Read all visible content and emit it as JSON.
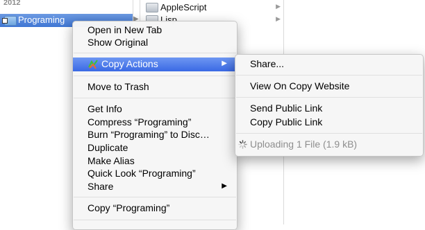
{
  "finder": {
    "year_label": "2012",
    "selected_folder": "Programing",
    "column2_items": [
      {
        "label": "AppleScript"
      },
      {
        "label": "Lisp"
      }
    ]
  },
  "context_menu": {
    "items": [
      {
        "label": "Open in New Tab"
      },
      {
        "label": "Show Original"
      },
      {
        "label": "Copy Actions"
      },
      {
        "label": "Move to Trash"
      },
      {
        "label": "Get Info"
      },
      {
        "label": "Compress “Programing”"
      },
      {
        "label": "Burn “Programing” to Disc…"
      },
      {
        "label": "Duplicate"
      },
      {
        "label": "Make Alias"
      },
      {
        "label": "Quick Look “Programing”"
      },
      {
        "label": "Share"
      },
      {
        "label": "Copy “Programing”"
      }
    ],
    "submenu_arrow": "▶"
  },
  "submenu": {
    "items": [
      {
        "label": "Share..."
      },
      {
        "label": "View On Copy Website"
      },
      {
        "label": "Send Public Link"
      },
      {
        "label": "Copy Public Link"
      },
      {
        "label": "Uploading 1 File (1.9 kB)"
      }
    ]
  },
  "colors": {
    "selection": "#3f76d4",
    "menu_highlight": "#3a69e4",
    "disabled_text": "#8e8e8e"
  },
  "icons": {
    "folder": "folder-icon",
    "alias": "alias-arrow-icon",
    "copy_actions": "copy-logo-icon",
    "spinner": "spinner-icon"
  }
}
